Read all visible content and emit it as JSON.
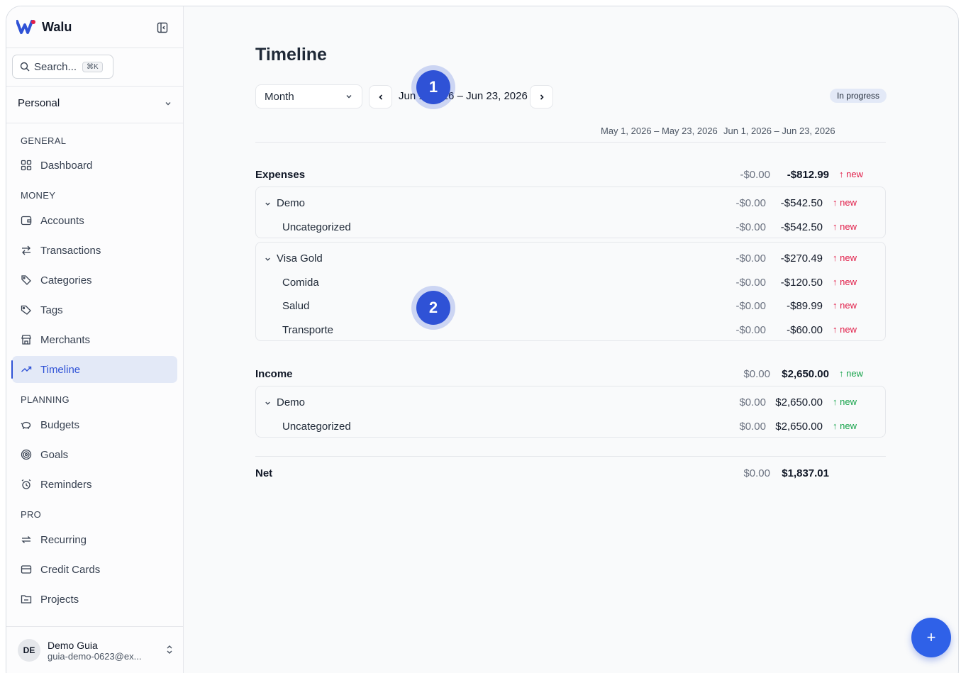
{
  "app": {
    "name": "Walu"
  },
  "search": {
    "placeholder": "Search...",
    "shortcut": "⌘K"
  },
  "workspace": {
    "selected": "Personal"
  },
  "sidebar": {
    "sections": [
      {
        "label": "GENERAL",
        "items": [
          {
            "label": "Dashboard",
            "icon": "dashboard-icon"
          }
        ]
      },
      {
        "label": "MONEY",
        "items": [
          {
            "label": "Accounts",
            "icon": "wallet-icon"
          },
          {
            "label": "Transactions",
            "icon": "transfer-icon"
          },
          {
            "label": "Categories",
            "icon": "tags-icon"
          },
          {
            "label": "Tags",
            "icon": "tag-icon"
          },
          {
            "label": "Merchants",
            "icon": "store-icon"
          },
          {
            "label": "Timeline",
            "icon": "trend-icon",
            "active": true
          }
        ]
      },
      {
        "label": "PLANNING",
        "items": [
          {
            "label": "Budgets",
            "icon": "piggy-bank-icon"
          },
          {
            "label": "Goals",
            "icon": "target-icon"
          },
          {
            "label": "Reminders",
            "icon": "alarm-icon"
          }
        ]
      },
      {
        "label": "PRO",
        "items": [
          {
            "label": "Recurring",
            "icon": "repeat-icon"
          },
          {
            "label": "Credit Cards",
            "icon": "credit-card-icon"
          },
          {
            "label": "Projects",
            "icon": "folder-icon"
          }
        ]
      }
    ]
  },
  "user": {
    "initials": "DE",
    "name": "Demo Guia",
    "email": "guia-demo-0623@ex..."
  },
  "page": {
    "title": "Timeline",
    "period": "Month",
    "range": "Jun 1, 2026 – Jun 23, 2026",
    "status": "In progress",
    "columns": [
      "May 1, 2026 – May 23, 2026",
      "Jun 1, 2026 – Jun 23, 2026"
    ]
  },
  "expenses": {
    "label": "Expenses",
    "prev": "-$0.00",
    "curr": "-$812.99",
    "change": "new",
    "groups": [
      {
        "label": "Demo",
        "prev": "-$0.00",
        "curr": "-$542.50",
        "change": "new",
        "rows": [
          {
            "label": "Uncategorized",
            "prev": "-$0.00",
            "curr": "-$542.50",
            "change": "new"
          }
        ]
      },
      {
        "label": "Visa Gold",
        "prev": "-$0.00",
        "curr": "-$270.49",
        "change": "new",
        "rows": [
          {
            "label": "Comida",
            "prev": "-$0.00",
            "curr": "-$120.50",
            "change": "new"
          },
          {
            "label": "Salud",
            "prev": "-$0.00",
            "curr": "-$89.99",
            "change": "new"
          },
          {
            "label": "Transporte",
            "prev": "-$0.00",
            "curr": "-$60.00",
            "change": "new"
          }
        ]
      }
    ]
  },
  "income": {
    "label": "Income",
    "prev": "$0.00",
    "curr": "$2,650.00",
    "change": "new",
    "groups": [
      {
        "label": "Demo",
        "prev": "$0.00",
        "curr": "$2,650.00",
        "change": "new",
        "rows": [
          {
            "label": "Uncategorized",
            "prev": "$0.00",
            "curr": "$2,650.00",
            "change": "new"
          }
        ]
      }
    ]
  },
  "net": {
    "label": "Net",
    "prev": "$0.00",
    "curr": "$1,837.01"
  },
  "overlays": {
    "step1": "1",
    "step2": "2"
  },
  "fab": {
    "label": "+"
  },
  "colors": {
    "accent": "#2f52d6",
    "negative": "#e11d48",
    "positive": "#16a34a",
    "active_bg": "#e3e9f7"
  }
}
